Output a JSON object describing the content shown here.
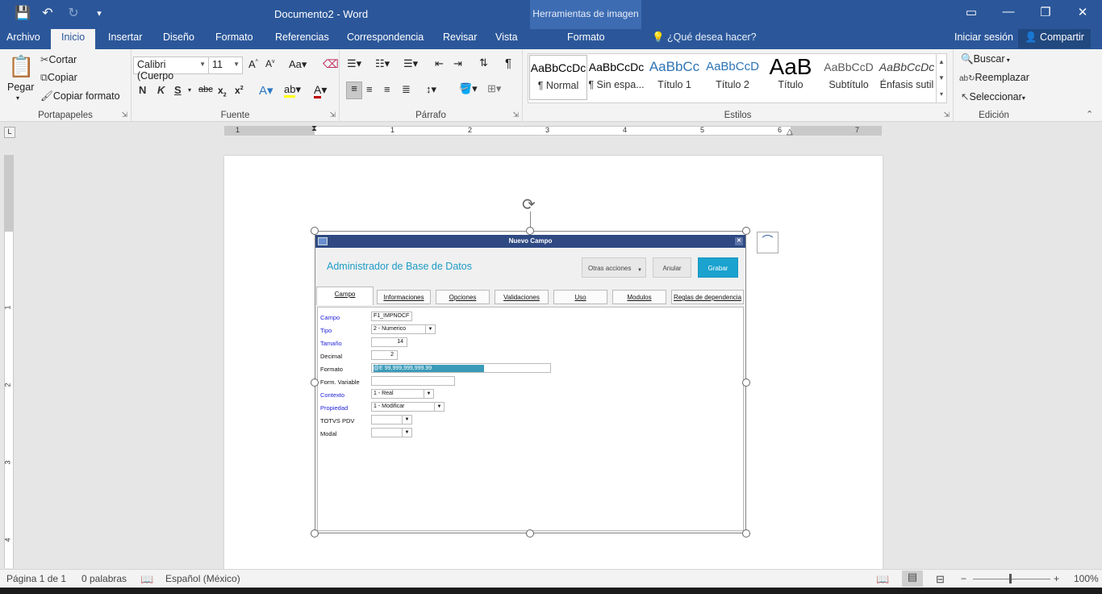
{
  "window": {
    "title": "Documento2 - Word",
    "context_group": "Herramientas de imagen",
    "qat": {
      "save_icon": "💾",
      "undo_icon": "↶",
      "redo_icon": "↻",
      "customize_icon": "▾"
    },
    "controls": {
      "ribbon_display": "▭",
      "minimize": "—",
      "restore": "❐",
      "close": "✕"
    }
  },
  "tabs": {
    "archivo": "Archivo",
    "inicio": "Inicio",
    "insertar": "Insertar",
    "diseno": "Diseño",
    "formato": "Formato",
    "referencias": "Referencias",
    "correspondencia": "Correspondencia",
    "revisar": "Revisar",
    "vista": "Vista",
    "formato_ctx": "Formato",
    "tell_me": "¿Qué desea hacer?",
    "sign_in": "Iniciar sesión",
    "share": "Compartir"
  },
  "ribbon": {
    "clipboard": {
      "label": "Portapapeles",
      "paste": "Pegar",
      "cut": "Cortar",
      "copy": "Copiar",
      "format_painter": "Copiar formato"
    },
    "font": {
      "label": "Fuente",
      "font_name": "Calibri (Cuerpo",
      "font_size": "11"
    },
    "paragraph": {
      "label": "Párrafo"
    },
    "styles": {
      "label": "Estilos",
      "items": [
        {
          "sample": "AaBbCcDc",
          "name": "¶ Normal"
        },
        {
          "sample": "AaBbCcDc",
          "name": "¶ Sin espa..."
        },
        {
          "sample": "AaBbCc",
          "name": "Título 1"
        },
        {
          "sample": "AaBbCcD",
          "name": "Título 2"
        },
        {
          "sample": "AaB",
          "name": "Título"
        },
        {
          "sample": "AaBbCcD",
          "name": "Subtítulo"
        },
        {
          "sample": "AaBbCcDc",
          "name": "Énfasis sutil"
        }
      ]
    },
    "editing": {
      "label": "Edición",
      "find": "Buscar",
      "replace": "Reemplazar",
      "select": "Seleccionar"
    }
  },
  "ruler": {
    "numbers": [
      "1",
      "1",
      "2",
      "3",
      "4",
      "5",
      "6",
      "7"
    ],
    "vnumbers": [
      "1",
      "2",
      "3",
      "4"
    ]
  },
  "picture": {
    "dialog_title": "Nuevo Campo",
    "header": "Administrador de Base de Datos",
    "buttons": {
      "otras": "Otras acciones",
      "anular": "Anular",
      "grabar": "Grabar"
    },
    "tabs": [
      "Campo",
      "Informaciones",
      "Opciones",
      "Validaciones",
      "Uso",
      "Modulos",
      "Reglas de dependencia"
    ],
    "fields": {
      "campo": {
        "label": "Campo",
        "value": "F1_IMPNOCF"
      },
      "tipo": {
        "label": "Tipo",
        "value": "2 - Numerico"
      },
      "tamano": {
        "label": "Tamaño",
        "value": "14"
      },
      "decimal": {
        "label": "Decimal",
        "value": "2"
      },
      "formato": {
        "label": "Formato",
        "value": "@E 99,999,999,999.99"
      },
      "form_variable": {
        "label": "Form. Variable",
        "value": ""
      },
      "contexto": {
        "label": "Contexto",
        "value": "1 - Real"
      },
      "propiedad": {
        "label": "Propiedad",
        "value": "1 - Modificar"
      },
      "totvs_pdv": {
        "label": "TOTVS PDV",
        "value": ""
      },
      "modal": {
        "label": "Modal",
        "value": ""
      }
    }
  },
  "status": {
    "page": "Página 1 de 1",
    "words": "0 palabras",
    "language": "Español (México)",
    "zoom": "100%",
    "zoom_minus": "−",
    "zoom_plus": "+"
  },
  "colors": {
    "accent": "#2b579a",
    "dialog_header": "#1e9bc6",
    "grabar": "#1ba2cf"
  }
}
